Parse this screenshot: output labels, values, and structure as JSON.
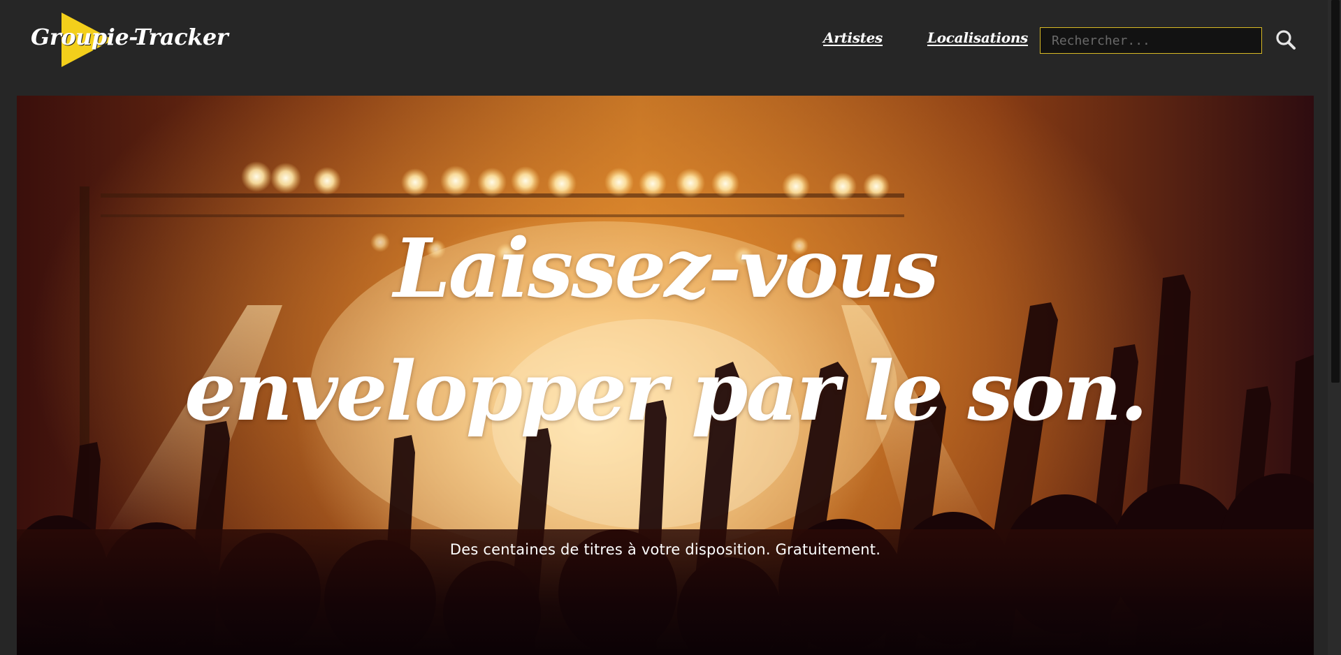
{
  "header": {
    "logo_text": "Groupie-Tracker",
    "nav": [
      {
        "label": "Artistes"
      },
      {
        "label": "Localisations"
      }
    ],
    "search": {
      "placeholder": "Rechercher...",
      "value": ""
    },
    "search_icon": "search-icon"
  },
  "hero": {
    "title": "Laissez-vous envelopper par le son.",
    "subtitle": "Des centaines de titres à votre disposition. Gratuitement.",
    "background": "concert-crowd-photo"
  },
  "colors": {
    "page_bg": "#262626",
    "accent_yellow": "#f3cf1b",
    "search_border": "#d8b924",
    "text": "#ffffff"
  }
}
